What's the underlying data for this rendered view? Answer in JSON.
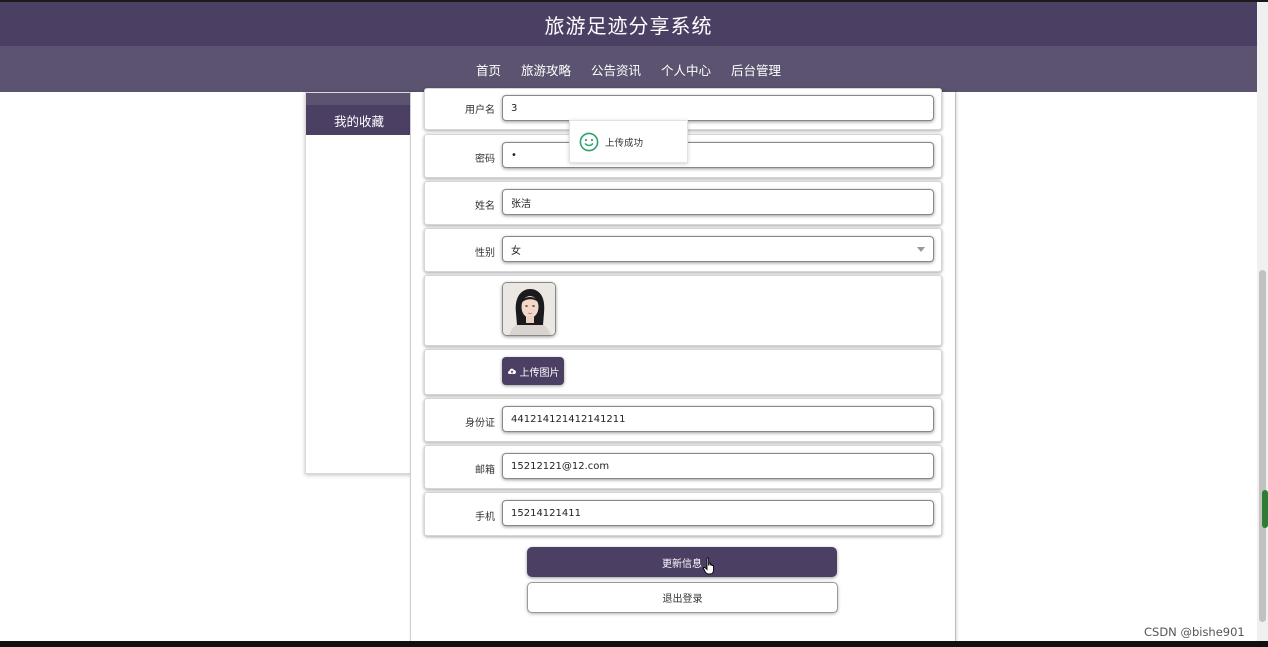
{
  "header": {
    "title": "旅游足迹分享系统"
  },
  "nav": {
    "items": [
      {
        "label": "首页"
      },
      {
        "label": "旅游攻略"
      },
      {
        "label": "公告资讯"
      },
      {
        "label": "个人中心"
      },
      {
        "label": "后台管理"
      }
    ],
    "active": "个人中心"
  },
  "sidebar": {
    "items": [
      {
        "label": "我的收藏"
      }
    ]
  },
  "form": {
    "username": {
      "label": "用户名",
      "value": "3"
    },
    "password": {
      "label": "密码",
      "value": "•"
    },
    "name": {
      "label": "姓名",
      "value": "张洁"
    },
    "gender": {
      "label": "性别",
      "value": "女"
    },
    "upload_label": "上传图片",
    "id_card": {
      "label": "身份证",
      "value": "441214121412141211"
    },
    "email": {
      "label": "邮箱",
      "value": "15212121@12.com"
    },
    "phone": {
      "label": "手机",
      "value": "15214121411"
    }
  },
  "buttons": {
    "update": "更新信息",
    "logout": "退出登录"
  },
  "toast": {
    "message": "上传成功"
  },
  "watermark": "CSDN @bishe901",
  "colors": {
    "primary": "#4b3f63",
    "nav": "#5b536f",
    "toast_icon": "#2fa36b"
  }
}
